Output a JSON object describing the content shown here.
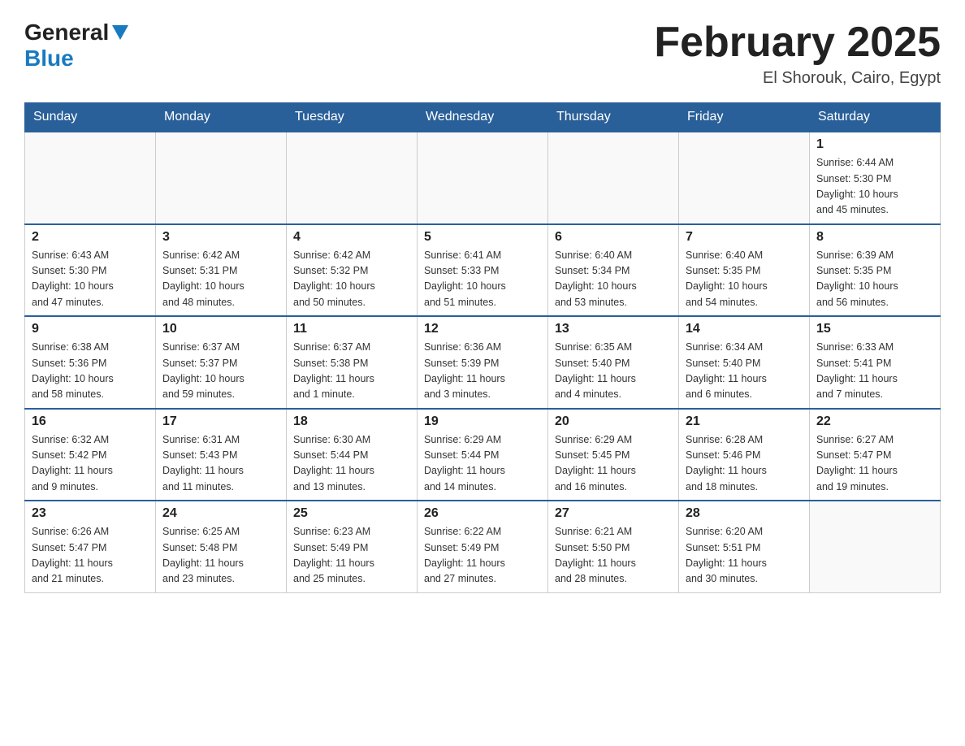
{
  "header": {
    "logo": {
      "general": "General",
      "blue": "Blue",
      "arrow_color": "#1a7abf"
    },
    "title": "February 2025",
    "subtitle": "El Shorouk, Cairo, Egypt"
  },
  "weekdays": [
    "Sunday",
    "Monday",
    "Tuesday",
    "Wednesday",
    "Thursday",
    "Friday",
    "Saturday"
  ],
  "weeks": [
    [
      {
        "day": "",
        "info": ""
      },
      {
        "day": "",
        "info": ""
      },
      {
        "day": "",
        "info": ""
      },
      {
        "day": "",
        "info": ""
      },
      {
        "day": "",
        "info": ""
      },
      {
        "day": "",
        "info": ""
      },
      {
        "day": "1",
        "info": "Sunrise: 6:44 AM\nSunset: 5:30 PM\nDaylight: 10 hours\nand 45 minutes."
      }
    ],
    [
      {
        "day": "2",
        "info": "Sunrise: 6:43 AM\nSunset: 5:30 PM\nDaylight: 10 hours\nand 47 minutes."
      },
      {
        "day": "3",
        "info": "Sunrise: 6:42 AM\nSunset: 5:31 PM\nDaylight: 10 hours\nand 48 minutes."
      },
      {
        "day": "4",
        "info": "Sunrise: 6:42 AM\nSunset: 5:32 PM\nDaylight: 10 hours\nand 50 minutes."
      },
      {
        "day": "5",
        "info": "Sunrise: 6:41 AM\nSunset: 5:33 PM\nDaylight: 10 hours\nand 51 minutes."
      },
      {
        "day": "6",
        "info": "Sunrise: 6:40 AM\nSunset: 5:34 PM\nDaylight: 10 hours\nand 53 minutes."
      },
      {
        "day": "7",
        "info": "Sunrise: 6:40 AM\nSunset: 5:35 PM\nDaylight: 10 hours\nand 54 minutes."
      },
      {
        "day": "8",
        "info": "Sunrise: 6:39 AM\nSunset: 5:35 PM\nDaylight: 10 hours\nand 56 minutes."
      }
    ],
    [
      {
        "day": "9",
        "info": "Sunrise: 6:38 AM\nSunset: 5:36 PM\nDaylight: 10 hours\nand 58 minutes."
      },
      {
        "day": "10",
        "info": "Sunrise: 6:37 AM\nSunset: 5:37 PM\nDaylight: 10 hours\nand 59 minutes."
      },
      {
        "day": "11",
        "info": "Sunrise: 6:37 AM\nSunset: 5:38 PM\nDaylight: 11 hours\nand 1 minute."
      },
      {
        "day": "12",
        "info": "Sunrise: 6:36 AM\nSunset: 5:39 PM\nDaylight: 11 hours\nand 3 minutes."
      },
      {
        "day": "13",
        "info": "Sunrise: 6:35 AM\nSunset: 5:40 PM\nDaylight: 11 hours\nand 4 minutes."
      },
      {
        "day": "14",
        "info": "Sunrise: 6:34 AM\nSunset: 5:40 PM\nDaylight: 11 hours\nand 6 minutes."
      },
      {
        "day": "15",
        "info": "Sunrise: 6:33 AM\nSunset: 5:41 PM\nDaylight: 11 hours\nand 7 minutes."
      }
    ],
    [
      {
        "day": "16",
        "info": "Sunrise: 6:32 AM\nSunset: 5:42 PM\nDaylight: 11 hours\nand 9 minutes."
      },
      {
        "day": "17",
        "info": "Sunrise: 6:31 AM\nSunset: 5:43 PM\nDaylight: 11 hours\nand 11 minutes."
      },
      {
        "day": "18",
        "info": "Sunrise: 6:30 AM\nSunset: 5:44 PM\nDaylight: 11 hours\nand 13 minutes."
      },
      {
        "day": "19",
        "info": "Sunrise: 6:29 AM\nSunset: 5:44 PM\nDaylight: 11 hours\nand 14 minutes."
      },
      {
        "day": "20",
        "info": "Sunrise: 6:29 AM\nSunset: 5:45 PM\nDaylight: 11 hours\nand 16 minutes."
      },
      {
        "day": "21",
        "info": "Sunrise: 6:28 AM\nSunset: 5:46 PM\nDaylight: 11 hours\nand 18 minutes."
      },
      {
        "day": "22",
        "info": "Sunrise: 6:27 AM\nSunset: 5:47 PM\nDaylight: 11 hours\nand 19 minutes."
      }
    ],
    [
      {
        "day": "23",
        "info": "Sunrise: 6:26 AM\nSunset: 5:47 PM\nDaylight: 11 hours\nand 21 minutes."
      },
      {
        "day": "24",
        "info": "Sunrise: 6:25 AM\nSunset: 5:48 PM\nDaylight: 11 hours\nand 23 minutes."
      },
      {
        "day": "25",
        "info": "Sunrise: 6:23 AM\nSunset: 5:49 PM\nDaylight: 11 hours\nand 25 minutes."
      },
      {
        "day": "26",
        "info": "Sunrise: 6:22 AM\nSunset: 5:49 PM\nDaylight: 11 hours\nand 27 minutes."
      },
      {
        "day": "27",
        "info": "Sunrise: 6:21 AM\nSunset: 5:50 PM\nDaylight: 11 hours\nand 28 minutes."
      },
      {
        "day": "28",
        "info": "Sunrise: 6:20 AM\nSunset: 5:51 PM\nDaylight: 11 hours\nand 30 minutes."
      },
      {
        "day": "",
        "info": ""
      }
    ]
  ]
}
